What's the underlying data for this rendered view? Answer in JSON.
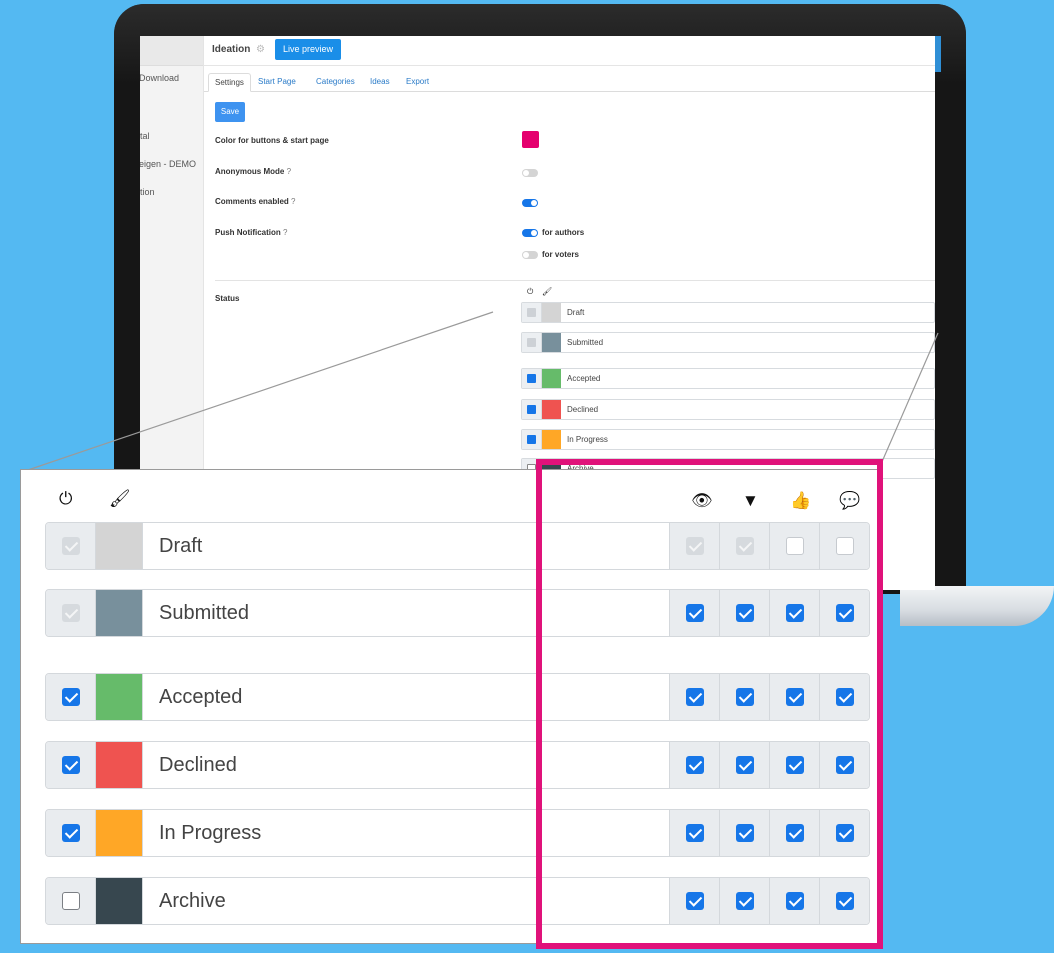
{
  "app": {
    "title": "Ideation",
    "live_preview": "Live preview"
  },
  "sidebar": {
    "items": [
      "Download",
      "tal",
      "eigen - DEMO",
      "tion"
    ]
  },
  "tabs": [
    "Settings",
    "Start Page",
    "Categories",
    "Ideas",
    "Export"
  ],
  "settings": {
    "save_label": "Save",
    "color_label": "Color for buttons & start page",
    "accent_color": "#e5006e",
    "anonymous_label": "Anonymous Mode",
    "anonymous_on": false,
    "comments_label": "Comments enabled",
    "comments_on": true,
    "push_label": "Push Notification",
    "push_authors_label": "for authors",
    "push_authors_on": true,
    "push_voters_label": "for voters",
    "push_voters_on": false,
    "status_label": "Status",
    "help_icon": "?"
  },
  "status_header_icons": {
    "left": [
      "power-icon",
      "brush-icon"
    ],
    "right": [
      "eye-icon",
      "filter-icon",
      "thumbs-up-icon",
      "comment-icon"
    ],
    "glyphs": {
      "power": "⏻",
      "brush": "🖌",
      "eye": "👁",
      "filter": "▼",
      "thumb": "👍",
      "comment": "💬"
    }
  },
  "statuses": [
    {
      "name": "Draft",
      "color": "#d4d4d4",
      "active": "dim",
      "perms": [
        "dim",
        "dim",
        "emptydim",
        "emptydim"
      ]
    },
    {
      "name": "Submitted",
      "color": "#78909c",
      "active": "dim",
      "perms": [
        "on",
        "on",
        "on",
        "on"
      ]
    },
    {
      "name": "Accepted",
      "color": "#66bb6a",
      "active": "on",
      "perms": [
        "on",
        "on",
        "on",
        "on"
      ]
    },
    {
      "name": "Declined",
      "color": "#ef5350",
      "active": "on",
      "perms": [
        "on",
        "on",
        "on",
        "on"
      ]
    },
    {
      "name": "In Progress",
      "color": "#ffa726",
      "active": "on",
      "perms": [
        "on",
        "on",
        "on",
        "on"
      ]
    },
    {
      "name": "Archive",
      "color": "#37474f",
      "active": "empty",
      "perms": [
        "on",
        "on",
        "on",
        "on"
      ]
    }
  ],
  "mini_partial_label": "Archive",
  "highlight_color": "#e0127a"
}
